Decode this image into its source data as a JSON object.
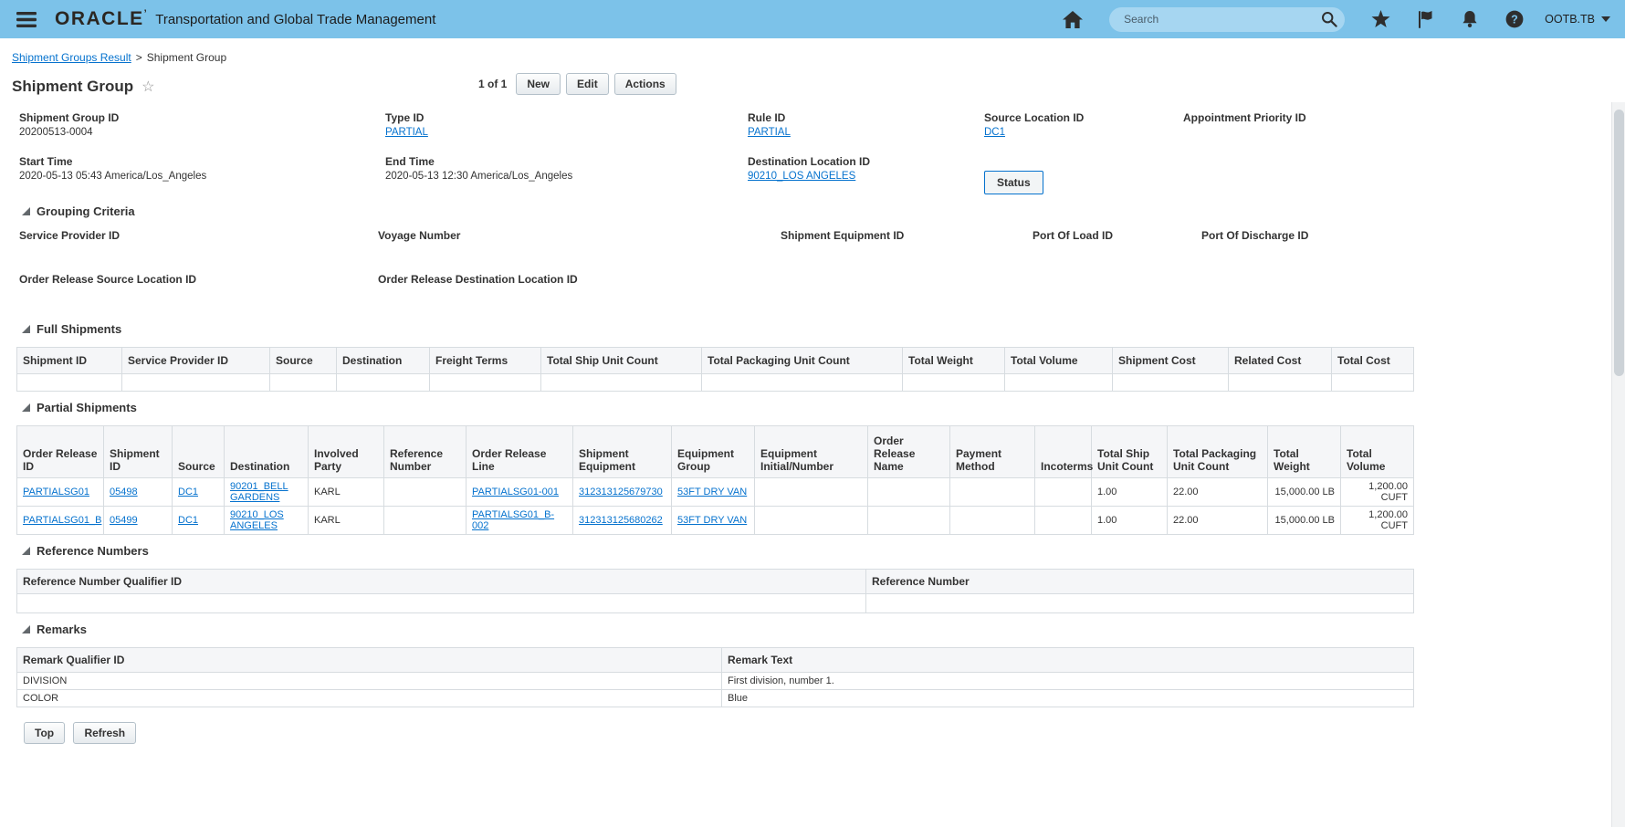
{
  "colors": {
    "header_bg": "#7cc2e9",
    "search_bg": "#a6d6f1",
    "link": "#0572ce"
  },
  "app": {
    "brand": "ORACLE",
    "title": "Transportation and Global Trade Management",
    "search_placeholder": "Search",
    "user_menu": "OOTB.TB"
  },
  "breadcrumb": {
    "parent": "Shipment Groups Result",
    "separator": ">",
    "current": "Shipment Group"
  },
  "title_bar": {
    "title": "Shipment Group",
    "record_count": "1 of 1",
    "new_button": "New",
    "edit_button": "Edit",
    "actions_button": "Actions"
  },
  "summary": {
    "row1": [
      {
        "label": "Shipment Group ID",
        "value": "20200513-0004",
        "is_link": false
      },
      {
        "label": "Type ID",
        "value": "PARTIAL",
        "is_link": true
      },
      {
        "label": "Rule ID",
        "value": "PARTIAL",
        "is_link": true
      },
      {
        "label": "Source Location ID",
        "value": "DC1",
        "is_link": true
      },
      {
        "label": "Appointment Priority ID",
        "value": "",
        "is_link": false
      }
    ],
    "row2": [
      {
        "label": "Start Time",
        "value": "2020-05-13 05:43 America/Los_Angeles",
        "is_link": false
      },
      {
        "label": "End Time",
        "value": "2020-05-13 12:30 America/Los_Angeles",
        "is_link": false
      },
      {
        "label": "Destination Location ID",
        "value": "90210_LOS ANGELES",
        "is_link": true
      }
    ],
    "status_button": "Status"
  },
  "grouping_criteria": {
    "section_title": "Grouping Criteria",
    "row1": [
      "Service Provider ID",
      "Voyage Number",
      "Shipment Equipment ID",
      "Port Of Load ID",
      "Port Of Discharge ID"
    ],
    "row2": [
      "Order Release Source Location ID",
      "Order Release Destination Location ID"
    ]
  },
  "full_shipments": {
    "section_title": "Full Shipments",
    "columns": [
      "Shipment ID",
      "Service Provider ID",
      "Source",
      "Destination",
      "Freight Terms",
      "Total Ship Unit Count",
      "Total Packaging Unit Count",
      "Total Weight",
      "Total Volume",
      "Shipment Cost",
      "Related Cost",
      "Total Cost"
    ],
    "rows": [
      [
        "",
        "",
        "",
        "",
        "",
        "",
        "",
        "",
        "",
        "",
        "",
        ""
      ]
    ]
  },
  "partial_shipments": {
    "section_title": "Partial Shipments",
    "columns": [
      "Order Release ID",
      "Shipment ID",
      "Source",
      "Destination",
      "Involved Party",
      "Reference Number",
      "Order Release Line",
      "Shipment Equipment",
      "Equipment Group",
      "Equipment Initial/Number",
      "Order Release Name",
      "Payment Method",
      "Incoterms",
      "Total Ship Unit Count",
      "Total Packaging Unit Count",
      "Total Weight",
      "Total Volume"
    ],
    "rows": [
      [
        "PARTIALSG01",
        "05498",
        "DC1",
        "90201_BELL GARDENS",
        "KARL",
        "",
        "PARTIALSG01-001",
        "312313125679730",
        "53FT DRY VAN",
        "",
        "",
        "",
        "",
        "1.00",
        "22.00",
        "15,000.00 LB",
        "1,200.00 CUFT"
      ],
      [
        "PARTIALSG01_B",
        "05499",
        "DC1",
        "90210_LOS ANGELES",
        "KARL",
        "",
        "PARTIALSG01_B-002",
        "312313125680262",
        "53FT DRY VAN",
        "",
        "",
        "",
        "",
        "1.00",
        "22.00",
        "15,000.00 LB",
        "1,200.00 CUFT"
      ]
    ]
  },
  "reference_numbers": {
    "section_title": "Reference Numbers",
    "columns": [
      "Reference Number Qualifier ID",
      "Reference Number"
    ],
    "rows": [
      [
        "",
        ""
      ]
    ]
  },
  "remarks": {
    "section_title": "Remarks",
    "columns": [
      "Remark Qualifier ID",
      "Remark Text"
    ],
    "rows": [
      [
        "DIVISION",
        "First division, number 1."
      ],
      [
        "COLOR",
        "Blue"
      ]
    ]
  },
  "footer": {
    "top_button": "Top",
    "refresh_button": "Refresh"
  }
}
